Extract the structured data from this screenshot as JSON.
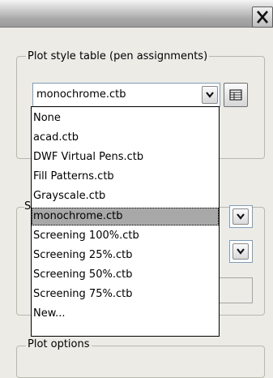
{
  "window": {
    "close_icon": "close-icon"
  },
  "plot_style_group": {
    "label": "Plot style table (pen assignments)",
    "combo_value": "monochrome.ctb",
    "edit_icon": "edit-table-icon"
  },
  "dropdown": {
    "selected": "monochrome.ctb",
    "items": [
      "None",
      "acad.ctb",
      "DWF Virtual Pens.ctb",
      "Fill Patterns.ctb",
      "Grayscale.ctb",
      "monochrome.ctb",
      "Screening 100%.ctb",
      "Screening 25%.ctb",
      "Screening 50%.ctb",
      "Screening 75%.ctb",
      "New..."
    ]
  },
  "shaded_group": {
    "label_fragment": "S"
  },
  "plot_options_group": {
    "label": "Plot options"
  }
}
